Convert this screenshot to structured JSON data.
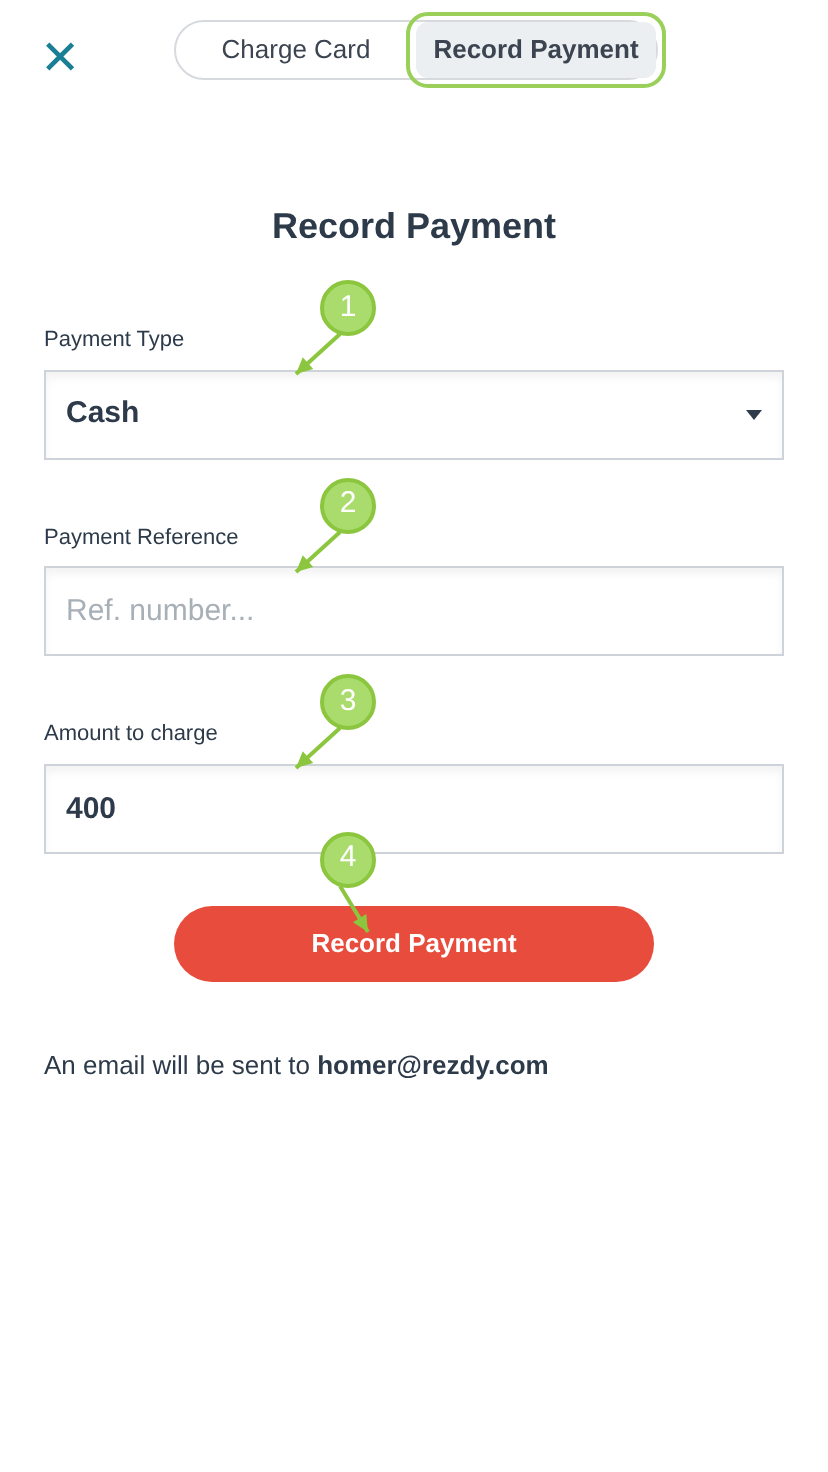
{
  "close": {
    "symbol": "✕"
  },
  "tabs": [
    {
      "label": "Charge Card",
      "selected": false,
      "highlighted": false
    },
    {
      "label": "Record Payment",
      "selected": true,
      "highlighted": true
    }
  ],
  "title": "Record Payment",
  "fields": [
    {
      "kind": "select",
      "label": "Payment Type",
      "value": "Cash",
      "callout": "1"
    },
    {
      "kind": "text",
      "label": "Payment Reference",
      "placeholder": "Ref. number...",
      "callout": "2"
    },
    {
      "kind": "text",
      "label": "Amount to charge",
      "value": "400",
      "callout": "3"
    }
  ],
  "submit": {
    "label": "Record Payment",
    "callout": "4"
  },
  "note": "An email will be sent to **homer@rezdy.com**"
}
